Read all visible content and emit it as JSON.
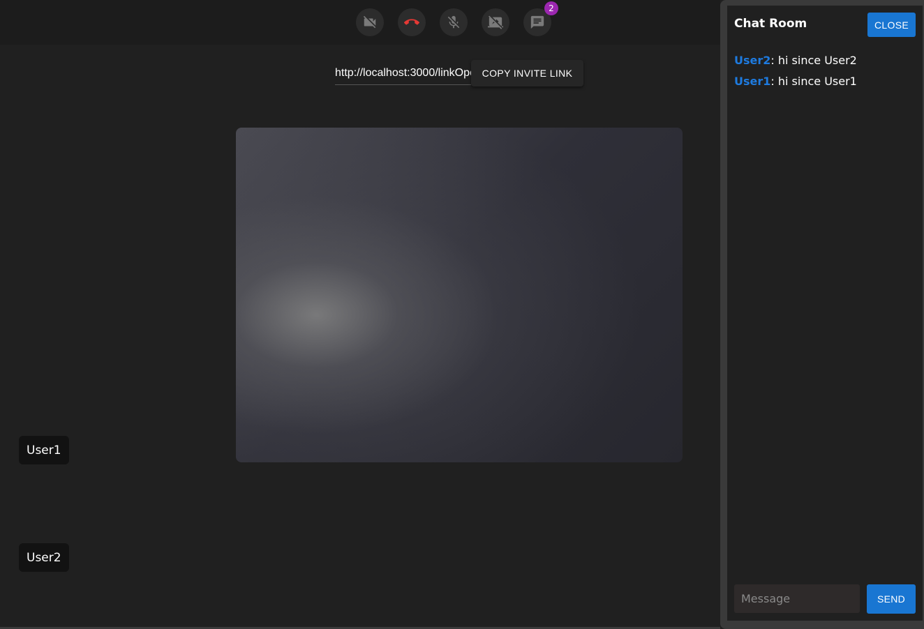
{
  "toolbar": {
    "buttons": [
      {
        "name": "video-off-icon",
        "color": "#7a7a7a"
      },
      {
        "name": "hang-up-icon",
        "color": "#e53935"
      },
      {
        "name": "mic-off-icon",
        "color": "#7a7a7a"
      },
      {
        "name": "screen-share-off-icon",
        "color": "#7a7a7a"
      },
      {
        "name": "chat-icon",
        "color": "#7a7a7a"
      }
    ],
    "chat_badge": "2",
    "badge_color": "#9c27b0"
  },
  "invite": {
    "link_value": "http://localhost:3000/linkOpen",
    "copy_label": "COPY INVITE LINK"
  },
  "participants": [
    "User1",
    "User2"
  ],
  "chat": {
    "title": "Chat Room",
    "close_label": "CLOSE",
    "messages": [
      {
        "user": "User2",
        "text": ": hi since User2"
      },
      {
        "user": "User1",
        "text": ": hi since User1"
      }
    ],
    "input_placeholder": "Message",
    "send_label": "SEND",
    "accent_color": "#1976d2",
    "username_color": "#1e7be0"
  }
}
